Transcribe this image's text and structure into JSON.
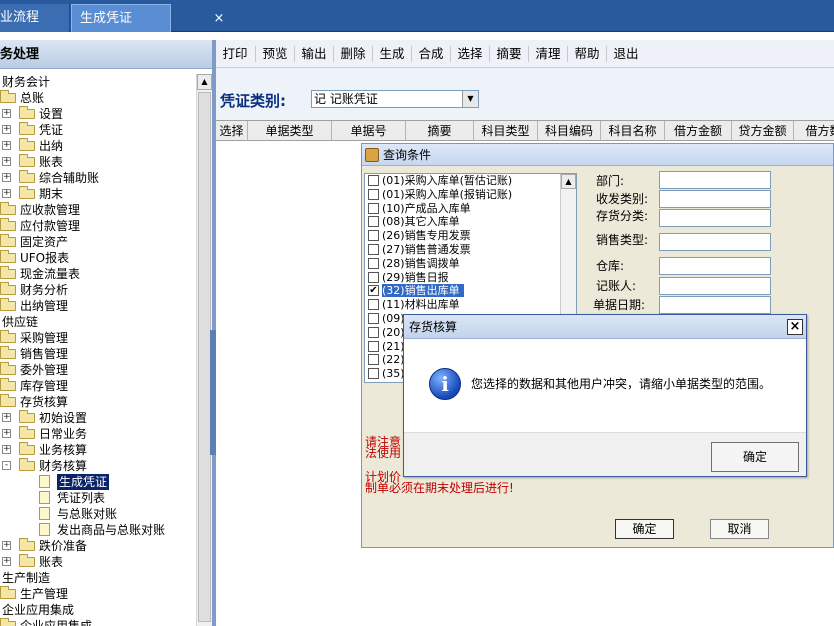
{
  "tabs": {
    "flow_label": "业流程",
    "active_label": "生成凭证",
    "close_glyph": "×"
  },
  "sidebar": {
    "header": "务处理",
    "tree": [
      {
        "label": "财务会计",
        "level": 0,
        "exp": "",
        "icon": "none"
      },
      {
        "label": "总账",
        "level": 1,
        "exp": "-",
        "icon": "folder"
      },
      {
        "label": "设置",
        "level": 2,
        "exp": "+",
        "icon": "folder"
      },
      {
        "label": "凭证",
        "level": 2,
        "exp": "+",
        "icon": "folder"
      },
      {
        "label": "出纳",
        "level": 2,
        "exp": "+",
        "icon": "folder"
      },
      {
        "label": "账表",
        "level": 2,
        "exp": "+",
        "icon": "folder"
      },
      {
        "label": "综合辅助账",
        "level": 2,
        "exp": "+",
        "icon": "folder"
      },
      {
        "label": "期末",
        "level": 2,
        "exp": "+",
        "icon": "folder"
      },
      {
        "label": "应收款管理",
        "level": 1,
        "exp": "",
        "icon": "folder"
      },
      {
        "label": "应付款管理",
        "level": 1,
        "exp": "",
        "icon": "folder"
      },
      {
        "label": "固定资产",
        "level": 1,
        "exp": "",
        "icon": "folder"
      },
      {
        "label": "UFO报表",
        "level": 1,
        "exp": "",
        "icon": "folder"
      },
      {
        "label": "现金流量表",
        "level": 1,
        "exp": "",
        "icon": "folder"
      },
      {
        "label": "财务分析",
        "level": 1,
        "exp": "",
        "icon": "folder"
      },
      {
        "label": "出纳管理",
        "level": 1,
        "exp": "",
        "icon": "folder"
      },
      {
        "label": "供应链",
        "level": 0,
        "exp": "",
        "icon": "none"
      },
      {
        "label": "采购管理",
        "level": 1,
        "exp": "",
        "icon": "folder"
      },
      {
        "label": "销售管理",
        "level": 1,
        "exp": "",
        "icon": "folder"
      },
      {
        "label": "委外管理",
        "level": 1,
        "exp": "",
        "icon": "folder"
      },
      {
        "label": "库存管理",
        "level": 1,
        "exp": "",
        "icon": "folder"
      },
      {
        "label": "存货核算",
        "level": 1,
        "exp": "-",
        "icon": "folder"
      },
      {
        "label": "初始设置",
        "level": 2,
        "exp": "+",
        "icon": "folder"
      },
      {
        "label": "日常业务",
        "level": 2,
        "exp": "+",
        "icon": "folder"
      },
      {
        "label": "业务核算",
        "level": 2,
        "exp": "+",
        "icon": "folder"
      },
      {
        "label": "财务核算",
        "level": 2,
        "exp": "-",
        "icon": "folder"
      },
      {
        "label": "生成凭证",
        "level": 3,
        "exp": "",
        "icon": "page",
        "selected": true
      },
      {
        "label": "凭证列表",
        "level": 3,
        "exp": "",
        "icon": "page"
      },
      {
        "label": "与总账对账",
        "level": 3,
        "exp": "",
        "icon": "page"
      },
      {
        "label": "发出商品与总账对账",
        "level": 3,
        "exp": "",
        "icon": "page"
      },
      {
        "label": "跌价准备",
        "level": 2,
        "exp": "+",
        "icon": "folder"
      },
      {
        "label": "账表",
        "level": 2,
        "exp": "+",
        "icon": "folder"
      },
      {
        "label": "生产制造",
        "level": 0,
        "exp": "",
        "icon": "none"
      },
      {
        "label": "生产管理",
        "level": 1,
        "exp": "",
        "icon": "folder"
      },
      {
        "label": "企业应用集成",
        "level": 0,
        "exp": "",
        "icon": "none"
      },
      {
        "label": "企业应用集成",
        "level": 1,
        "exp": "",
        "icon": "folder"
      }
    ],
    "scroll_up_glyph": "▲"
  },
  "toolbar": {
    "buttons": [
      "打印",
      "预览",
      "输出",
      "删除",
      "生成",
      "合成",
      "选择",
      "摘要",
      "清理",
      "帮助",
      "退出"
    ]
  },
  "voucher": {
    "label": "凭证类别:",
    "selected": "记 记账凭证",
    "arrow": "▼"
  },
  "grid": {
    "columns": [
      "选择",
      "单据类型",
      "单据号",
      "摘要",
      "科目类型",
      "科目编码",
      "科目名称",
      "借方金额",
      "贷方金额",
      "借方数"
    ]
  },
  "query_dialog": {
    "title": "查询条件",
    "bill_items": [
      {
        "label": "(01)采购入库单(暂估记账)",
        "checked": false
      },
      {
        "label": "(01)采购入库单(报销记账)",
        "checked": false
      },
      {
        "label": "(10)产成品入库单",
        "checked": false
      },
      {
        "label": "(08)其它入库单",
        "checked": false
      },
      {
        "label": "(26)销售专用发票",
        "checked": false
      },
      {
        "label": "(27)销售普通发票",
        "checked": false
      },
      {
        "label": "(28)销售调拨单",
        "checked": false
      },
      {
        "label": "(29)销售日报",
        "checked": false
      },
      {
        "label": "(32)销售出库单",
        "checked": true,
        "selected": true
      },
      {
        "label": "(11)材料出库单",
        "checked": false
      },
      {
        "label": "(09)",
        "checked": false
      },
      {
        "label": "(20)",
        "checked": false
      },
      {
        "label": "(21)",
        "checked": false
      },
      {
        "label": "(22)",
        "checked": false
      },
      {
        "label": "(35)",
        "checked": false
      }
    ],
    "check_glyph": "✔",
    "scroll_up_glyph": "▲",
    "fields": {
      "dept": "部门:",
      "sr_type": "收发类别:",
      "stock_class": "存货分类:",
      "sales_type": "销售类型:",
      "warehouse": "仓库:",
      "bookkeeper": "记账人:",
      "bill_date": "单据日期:"
    },
    "note": [
      "请注意",
      "法使用",
      "计划价",
      "制单必须在期末处理后进行!"
    ],
    "ok_label": "确定",
    "cancel_label": "取消"
  },
  "alert_dialog": {
    "title": "存货核算",
    "close_glyph": "×",
    "info_glyph": "i",
    "message": "您选择的数据和其他用户冲突，请缩小单据类型的范围。",
    "ok_label": "确定"
  }
}
